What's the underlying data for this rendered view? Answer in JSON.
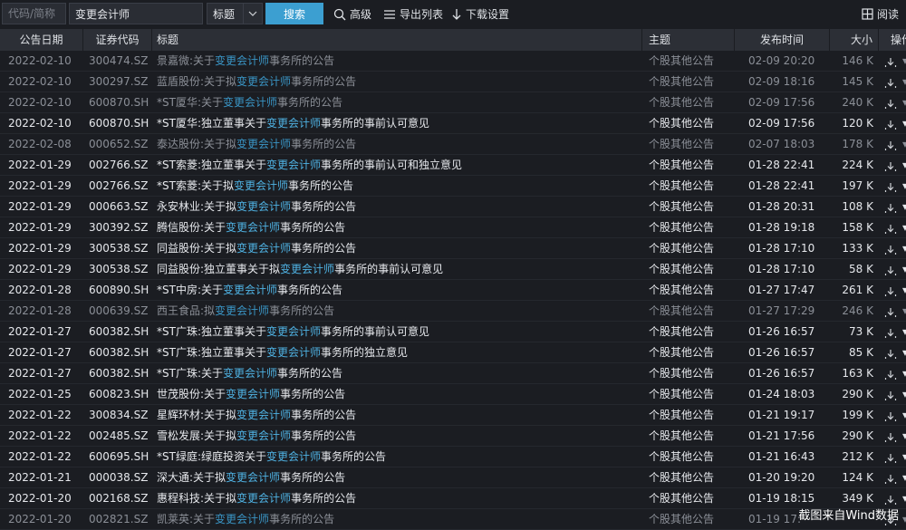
{
  "toolbar": {
    "code_placeholder": "代码/简称",
    "keyword_value": "变更会计师",
    "field_select": "标题",
    "search_label": "搜索",
    "advanced_label": "高级",
    "export_label": "导出列表",
    "download_settings_label": "下载设置",
    "reading_mode_label": "阅读"
  },
  "columns": {
    "date": "公告日期",
    "code": "证券代码",
    "title": "标题",
    "topic": "主题",
    "time": "发布时间",
    "size": "大小",
    "action": "操作"
  },
  "rows": [
    {
      "date": "2022-02-10",
      "code": "300474.SZ",
      "pre": "景嘉微:关于",
      "hl": "变更会计师",
      "post": "事务所的公告",
      "topic": "个股其他公告",
      "time": "02-09 20:20",
      "size": "146 K",
      "read": true
    },
    {
      "date": "2022-02-10",
      "code": "300297.SZ",
      "pre": "蓝盾股份:关于拟",
      "hl": "变更会计师",
      "post": "事务所的公告",
      "topic": "个股其他公告",
      "time": "02-09 18:16",
      "size": "145 K",
      "read": true
    },
    {
      "date": "2022-02-10",
      "code": "600870.SH",
      "pre": "*ST厦华:关于",
      "hl": "变更会计师",
      "post": "事务所的公告",
      "topic": "个股其他公告",
      "time": "02-09 17:56",
      "size": "240 K",
      "read": true
    },
    {
      "date": "2022-02-10",
      "code": "600870.SH",
      "pre": "*ST厦华:独立董事关于",
      "hl": "变更会计师",
      "post": "事务所的事前认可意见",
      "topic": "个股其他公告",
      "time": "02-09 17:56",
      "size": "120 K",
      "read": false
    },
    {
      "date": "2022-02-08",
      "code": "000652.SZ",
      "pre": "泰达股份:关于拟",
      "hl": "变更会计师",
      "post": "事务所的公告",
      "topic": "个股其他公告",
      "time": "02-07 18:03",
      "size": "178 K",
      "read": true
    },
    {
      "date": "2022-01-29",
      "code": "002766.SZ",
      "pre": "*ST索菱:独立董事关于",
      "hl": "变更会计师",
      "post": "事务所的事前认可和独立意见",
      "topic": "个股其他公告",
      "time": "01-28 22:41",
      "size": "224 K",
      "read": false
    },
    {
      "date": "2022-01-29",
      "code": "002766.SZ",
      "pre": "*ST索菱:关于拟",
      "hl": "变更会计师",
      "post": "事务所的公告",
      "topic": "个股其他公告",
      "time": "01-28 22:41",
      "size": "197 K",
      "read": false
    },
    {
      "date": "2022-01-29",
      "code": "000663.SZ",
      "pre": "永安林业:关于拟",
      "hl": "变更会计师",
      "post": "事务所的公告",
      "topic": "个股其他公告",
      "time": "01-28 20:31",
      "size": "108 K",
      "read": false
    },
    {
      "date": "2022-01-29",
      "code": "300392.SZ",
      "pre": "腾信股份:关于",
      "hl": "变更会计师",
      "post": "事务所的公告",
      "topic": "个股其他公告",
      "time": "01-28 19:18",
      "size": "158 K",
      "read": false
    },
    {
      "date": "2022-01-29",
      "code": "300538.SZ",
      "pre": "同益股份:关于拟",
      "hl": "变更会计师",
      "post": "事务所的公告",
      "topic": "个股其他公告",
      "time": "01-28 17:10",
      "size": "133 K",
      "read": false
    },
    {
      "date": "2022-01-29",
      "code": "300538.SZ",
      "pre": "同益股份:独立董事关于拟",
      "hl": "变更会计师",
      "post": "事务所的事前认可意见",
      "topic": "个股其他公告",
      "time": "01-28 17:10",
      "size": "58 K",
      "read": false
    },
    {
      "date": "2022-01-28",
      "code": "600890.SH",
      "pre": "*ST中房:关于",
      "hl": "变更会计师",
      "post": "事务所的公告",
      "topic": "个股其他公告",
      "time": "01-27 17:47",
      "size": "261 K",
      "read": false
    },
    {
      "date": "2022-01-28",
      "code": "000639.SZ",
      "pre": "西王食品:拟",
      "hl": "变更会计师",
      "post": "事务所的公告",
      "topic": "个股其他公告",
      "time": "01-27 17:29",
      "size": "246 K",
      "read": true
    },
    {
      "date": "2022-01-27",
      "code": "600382.SH",
      "pre": "*ST广珠:独立董事关于",
      "hl": "变更会计师",
      "post": "事务所的事前认可意见",
      "topic": "个股其他公告",
      "time": "01-26 16:57",
      "size": "73 K",
      "read": false
    },
    {
      "date": "2022-01-27",
      "code": "600382.SH",
      "pre": "*ST广珠:独立董事关于",
      "hl": "变更会计师",
      "post": "事务所的独立意见",
      "topic": "个股其他公告",
      "time": "01-26 16:57",
      "size": "85 K",
      "read": false
    },
    {
      "date": "2022-01-27",
      "code": "600382.SH",
      "pre": "*ST广珠:关于",
      "hl": "变更会计师",
      "post": "事务所的公告",
      "topic": "个股其他公告",
      "time": "01-26 16:57",
      "size": "163 K",
      "read": false
    },
    {
      "date": "2022-01-25",
      "code": "600823.SH",
      "pre": "世茂股份:关于",
      "hl": "变更会计师",
      "post": "事务所的公告",
      "topic": "个股其他公告",
      "time": "01-24 18:03",
      "size": "290 K",
      "read": false
    },
    {
      "date": "2022-01-22",
      "code": "300834.SZ",
      "pre": "星辉环材:关于拟",
      "hl": "变更会计师",
      "post": "事务所的公告",
      "topic": "个股其他公告",
      "time": "01-21 19:17",
      "size": "199 K",
      "read": false
    },
    {
      "date": "2022-01-22",
      "code": "002485.SZ",
      "pre": "雪松发展:关于拟",
      "hl": "变更会计师",
      "post": "事务所的公告",
      "topic": "个股其他公告",
      "time": "01-21 17:56",
      "size": "290 K",
      "read": false
    },
    {
      "date": "2022-01-22",
      "code": "600695.SH",
      "pre": "*ST绿庭:绿庭投资关于",
      "hl": "变更会计师",
      "post": "事务所的公告",
      "topic": "个股其他公告",
      "time": "01-21 16:43",
      "size": "212 K",
      "read": false
    },
    {
      "date": "2022-01-21",
      "code": "000038.SZ",
      "pre": "深大通:关于拟",
      "hl": "变更会计师",
      "post": "事务所的公告",
      "topic": "个股其他公告",
      "time": "01-20 19:20",
      "size": "124 K",
      "read": false
    },
    {
      "date": "2022-01-20",
      "code": "002168.SZ",
      "pre": "惠程科技:关于拟",
      "hl": "变更会计师",
      "post": "事务所的公告",
      "topic": "个股其他公告",
      "time": "01-19 18:15",
      "size": "349 K",
      "read": false
    },
    {
      "date": "2022-01-20",
      "code": "002821.SZ",
      "pre": "凯莱英:关于",
      "hl": "变更会计师",
      "post": "事务所的公告",
      "topic": "个股其他公告",
      "time": "01-19 17:",
      "size": "",
      "read": true
    }
  ],
  "watermark": "截图来自Wind数据"
}
